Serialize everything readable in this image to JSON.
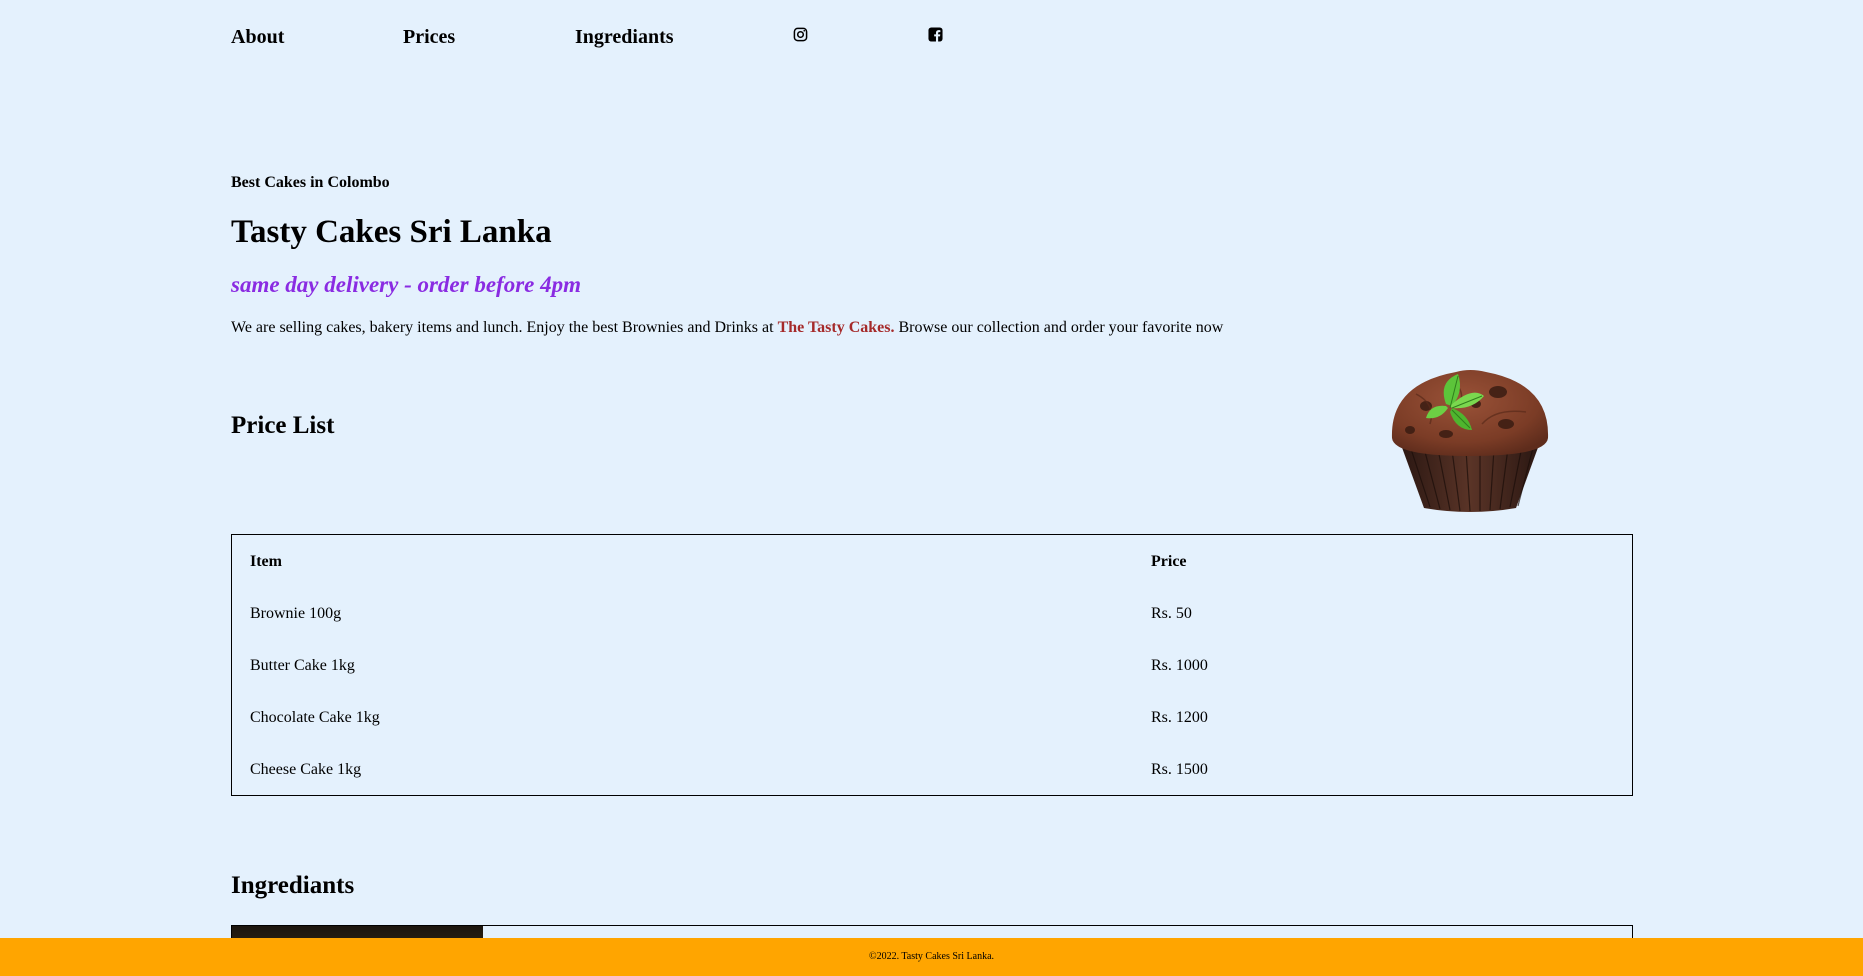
{
  "nav": {
    "about": "About",
    "prices": "Prices",
    "ingredients": "Ingrediants",
    "instagram_icon": "instagram-icon",
    "facebook_icon": "facebook-icon"
  },
  "hero": {
    "tagline": "Best Cakes in Colombo",
    "title": "Tasty Cakes Sri Lanka",
    "delivery": "same day delivery - order before 4pm",
    "intro_before": "We are selling cakes, bakery items and lunch. Enjoy the best Brownies and Drinks at ",
    "intro_brand": "The Tasty Cakes.",
    "intro_after": " Browse our collection and order your favorite now"
  },
  "price_list": {
    "heading": "Price List",
    "columns": {
      "item": "Item",
      "price": "Price"
    },
    "rows": [
      {
        "item": "Brownie 100g",
        "price": "Rs. 50"
      },
      {
        "item": "Butter Cake 1kg",
        "price": "Rs. 1000"
      },
      {
        "item": "Chocolate Cake 1kg",
        "price": "Rs. 1200"
      },
      {
        "item": "Cheese Cake 1kg",
        "price": "Rs. 1500"
      }
    ]
  },
  "ingredients": {
    "heading": "Ingrediants"
  },
  "footer": {
    "text": "©2022. Tasty Cakes Sri Lanka."
  },
  "colors": {
    "background": "#e4f1fd",
    "accent_purple": "#8a2be2",
    "brand_red": "#a52a2a",
    "footer_orange": "#ffa500"
  }
}
